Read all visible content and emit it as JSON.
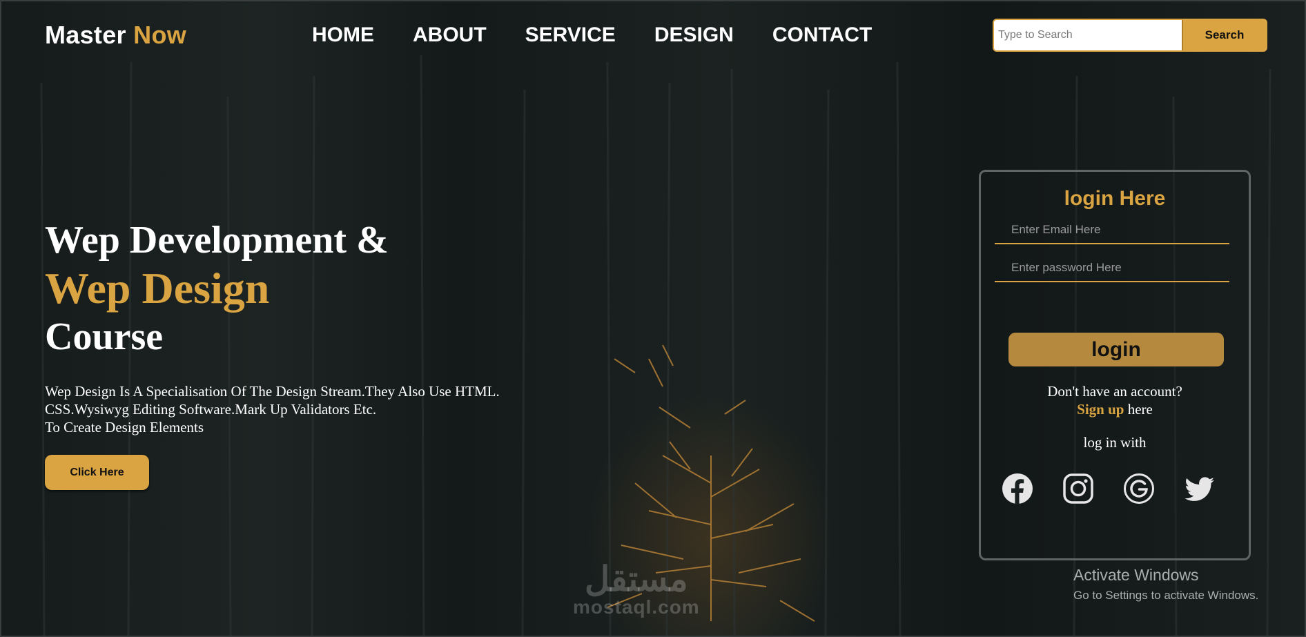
{
  "brand": {
    "name": "Master",
    "accent": "Now"
  },
  "nav": {
    "items": [
      "HOME",
      "ABOUT",
      "SERVICE",
      "DESIGN",
      "CONTACT"
    ]
  },
  "search": {
    "placeholder": "Type to Search",
    "button": "Search"
  },
  "hero": {
    "line1": "Wep Development &",
    "line2": "Wep Design",
    "line3": "Course",
    "desc": [
      "Wep Design Is A Specialisation Of The Design Stream.They Also Use HTML.",
      "CSS.Wysiwyg Editing Software.Mark Up Validators Etc.",
      "To Create Design Elements"
    ],
    "cta": "Click Here"
  },
  "login": {
    "title": "login Here",
    "email_placeholder": "Enter Email Here",
    "password_placeholder": "Enter password Here",
    "button": "login",
    "no_account": "Don't have an account?",
    "signup_link": "Sign up",
    "signup_suffix": "here",
    "login_with": "log in with",
    "socials": [
      "facebook-icon",
      "instagram-icon",
      "google-icon",
      "twitter-icon"
    ]
  },
  "watermarks": {
    "activate_title": "Activate Windows",
    "activate_sub": "Go to Settings to activate Windows.",
    "mostaql_ar": "مستقل",
    "mostaql_en": "mostaql.com"
  },
  "colors": {
    "accent": "#d9a441",
    "button_dark": "#b58a3e",
    "bg": "#1a1f1f",
    "card_border": "#5f6464"
  }
}
